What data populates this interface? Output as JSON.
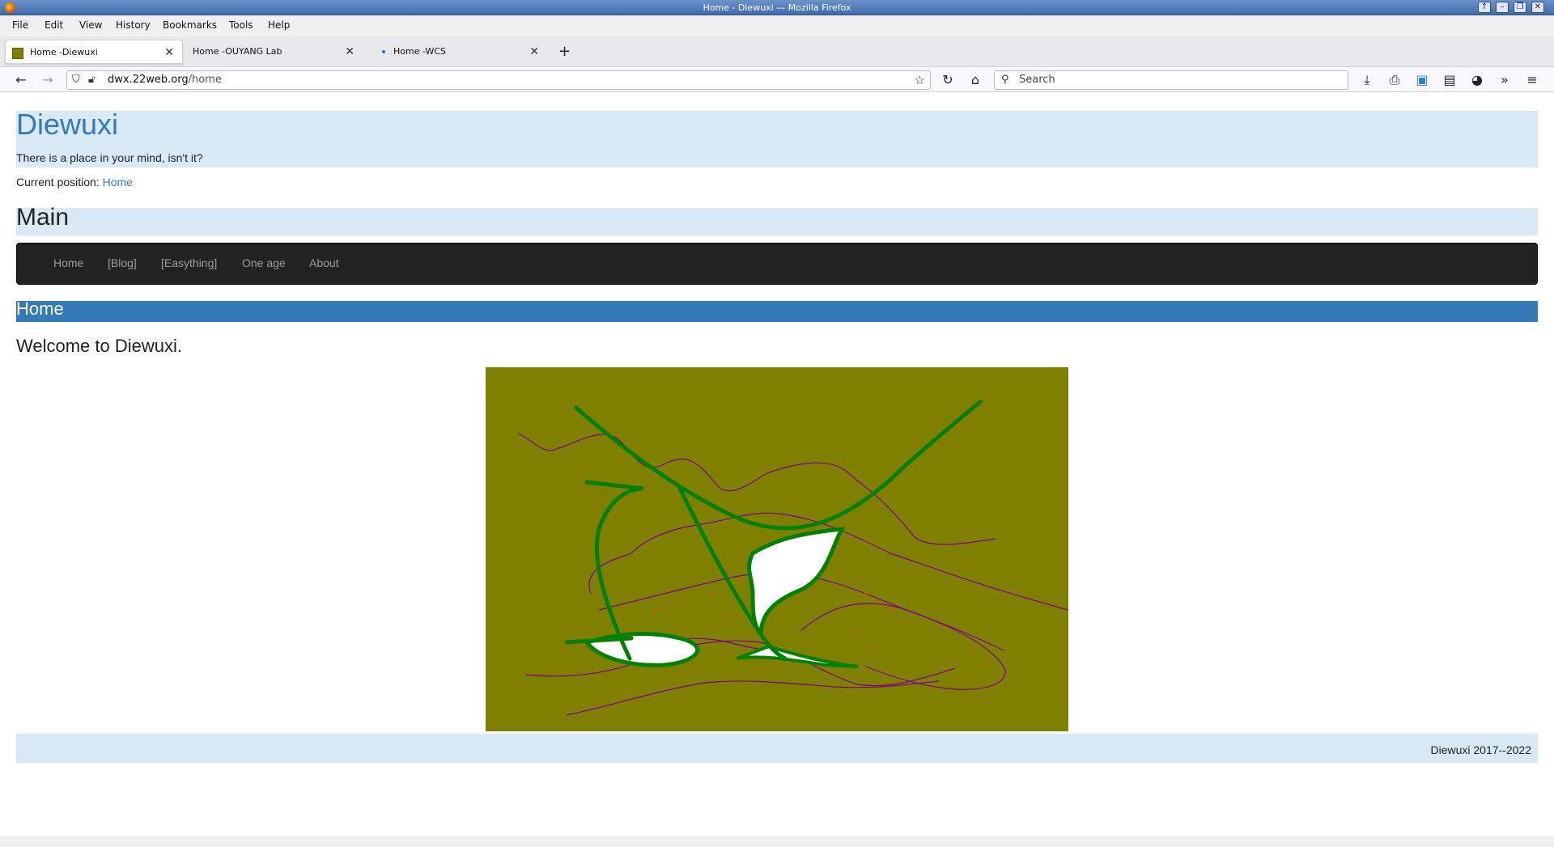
{
  "window": {
    "title": "Home - Diewuxi — Mozilla Firefox",
    "controls": [
      "↑",
      "–",
      "❐",
      "✕"
    ]
  },
  "menu": [
    "File",
    "Edit",
    "View",
    "History",
    "Bookmarks",
    "Tools",
    "Help"
  ],
  "tabs": [
    {
      "label": "Home -Diewuxi",
      "active": true
    },
    {
      "label": "Home -OUYANG Lab",
      "active": false
    },
    {
      "label": "Home -WCS",
      "active": false
    }
  ],
  "toolbar": {
    "url_domain": "dwx.22web.org",
    "url_path": "/home",
    "search_placeholder": "Search"
  },
  "site": {
    "title": "Diewuxi",
    "tagline": "There is a place in your mind, isn't it?",
    "position_label": "Current position:",
    "position_link": "Home",
    "main_heading": "Main",
    "nav": [
      "Home",
      "[Blog]",
      "[Easything]",
      "One age",
      "About"
    ],
    "section_heading": "Home",
    "welcome": "Welcome to Diewuxi.",
    "footer": "Diewuxi 2017--2022"
  },
  "colors": {
    "link": "#337ab7",
    "band": "#d9eaf6",
    "navbar": "#222222",
    "art_bg": "#808000",
    "art_green": "#008000",
    "art_purple": "#800080"
  }
}
